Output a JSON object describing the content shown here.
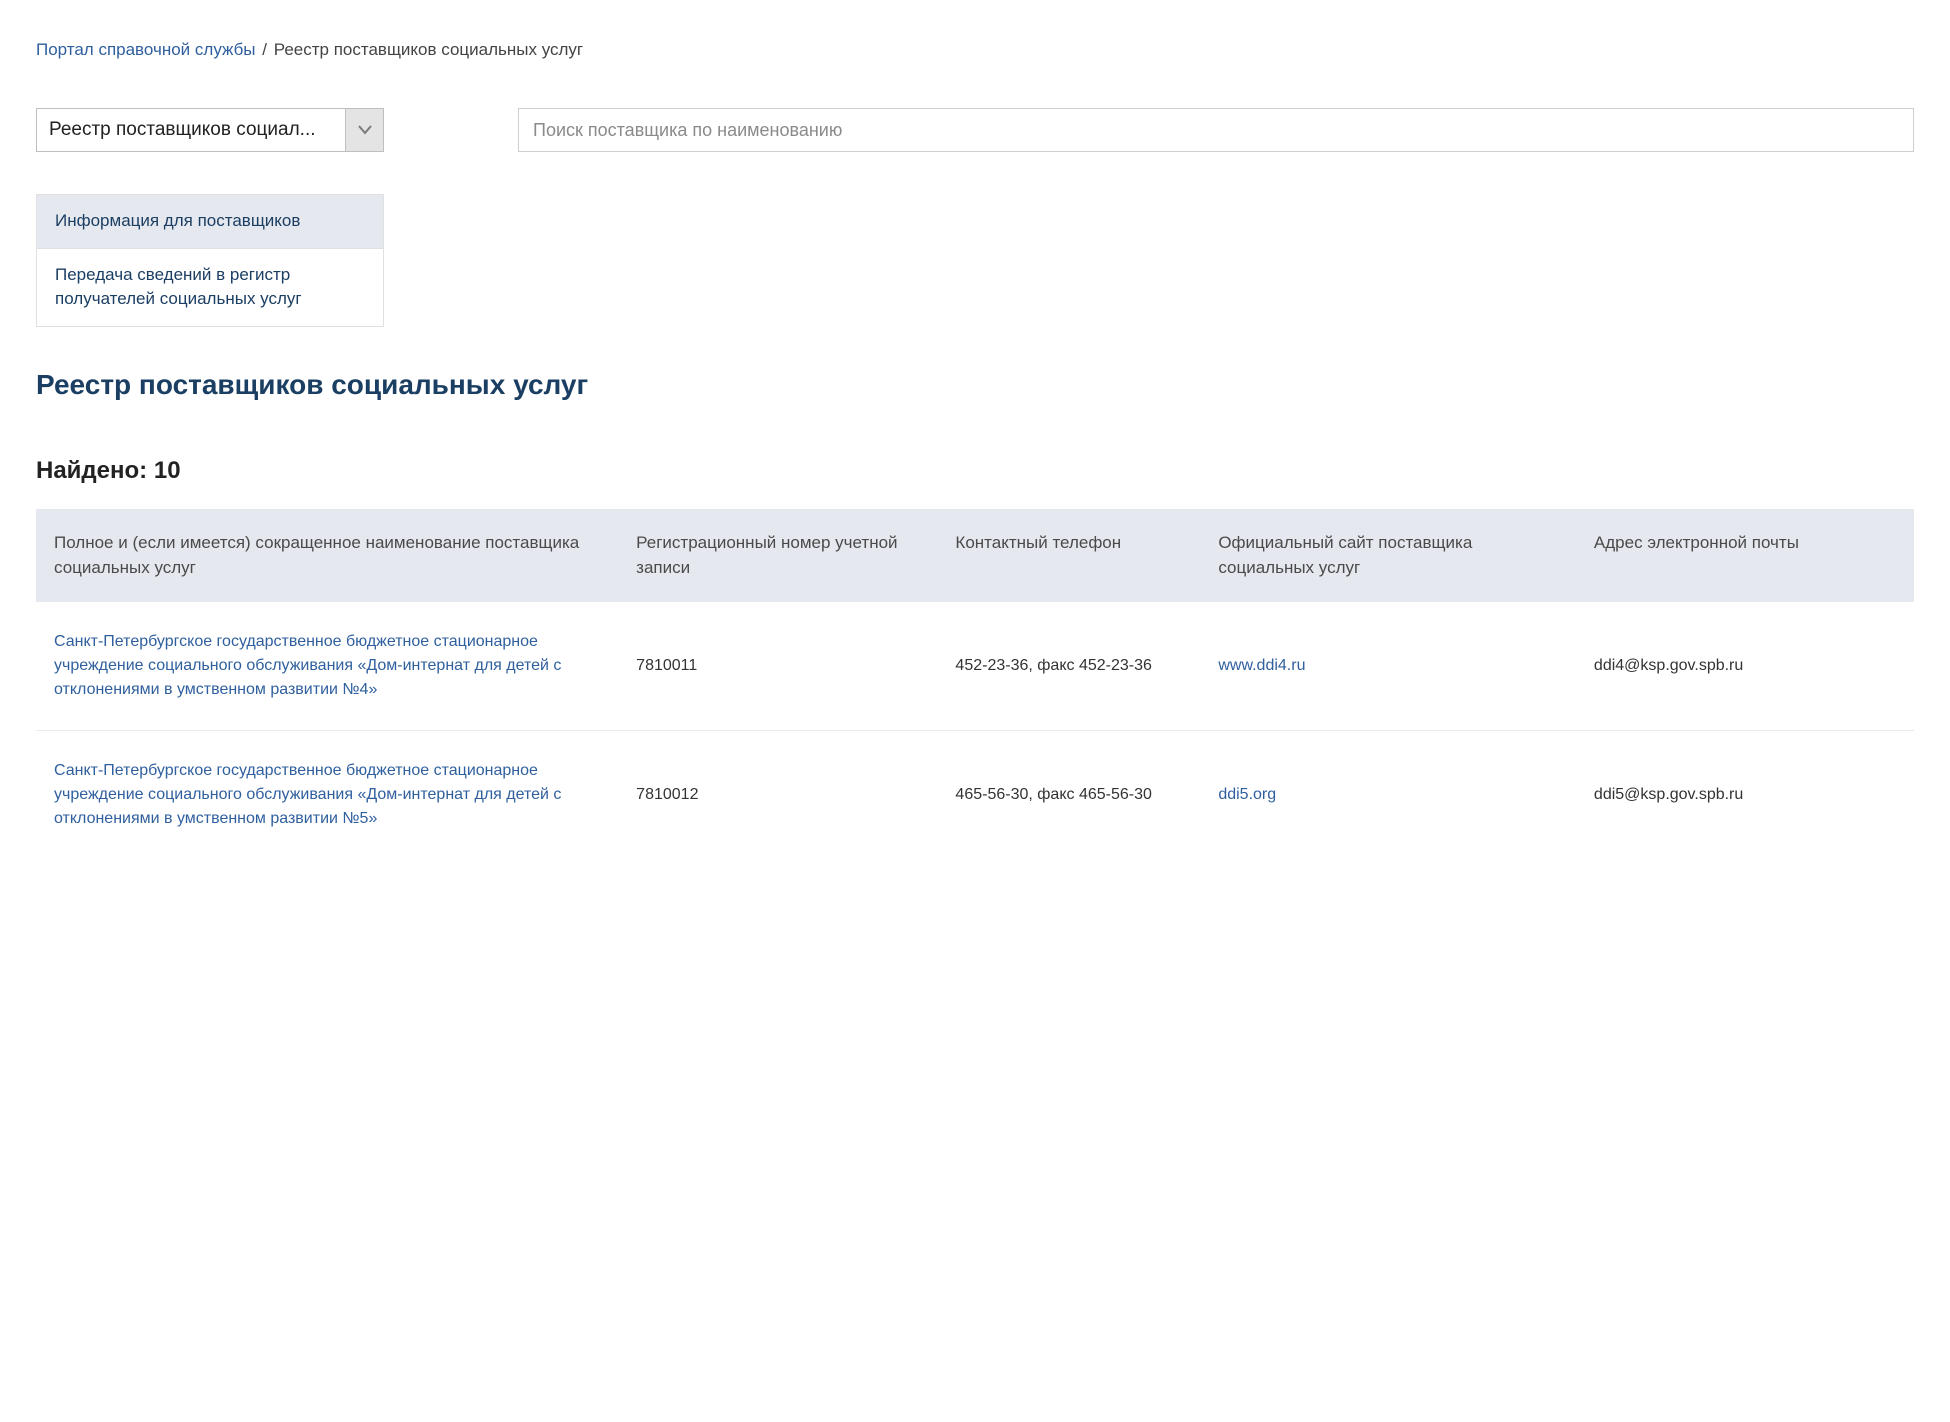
{
  "breadcrumb": {
    "root_label": "Портал справочной службы",
    "current": "Реестр поставщиков социальных услуг"
  },
  "select": {
    "text": "Реестр поставщиков социал..."
  },
  "menu": {
    "items": [
      {
        "label": "Информация для поставщиков",
        "active": true
      },
      {
        "label": "Передача сведений в регистр получателей социальных услуг",
        "active": false
      }
    ]
  },
  "search": {
    "placeholder": "Поиск поставщика по наименованию",
    "value": ""
  },
  "page_title": "Реестр поставщиков социальных услуг",
  "found_prefix": "Найдено: ",
  "found_count": "10",
  "table": {
    "headers": {
      "name": "Полное и (если имеется) сокращенное наименование поставщика социальных услуг",
      "reg": "Регистрационный номер учетной записи",
      "phone": "Контактный телефон",
      "site": "Официальный сайт поставщика социальных услуг",
      "email": "Адрес электронной почты"
    },
    "rows": [
      {
        "name": "Санкт‑Петербургское государственное бюджетное стационарное учреждение социального обслуживания «Дом‑интернат для детей с отклонениями в умственном развитии №4»",
        "reg": "7810011",
        "phone": "452‑23‑36, факс 452‑23‑36",
        "site": "www.ddi4.ru",
        "email": "ddi4@ksp.gov.spb.ru"
      },
      {
        "name": "Санкт‑Петербургское государственное бюджетное стационарное учреждение социального обслуживания «Дом‑интернат для детей с отклонениями в умственном развитии №5»",
        "reg": "7810012",
        "phone": "465‑56‑30, факс 465‑56‑30",
        "site": "ddi5.org",
        "email": "ddi5@ksp.gov.spb.ru"
      }
    ]
  }
}
